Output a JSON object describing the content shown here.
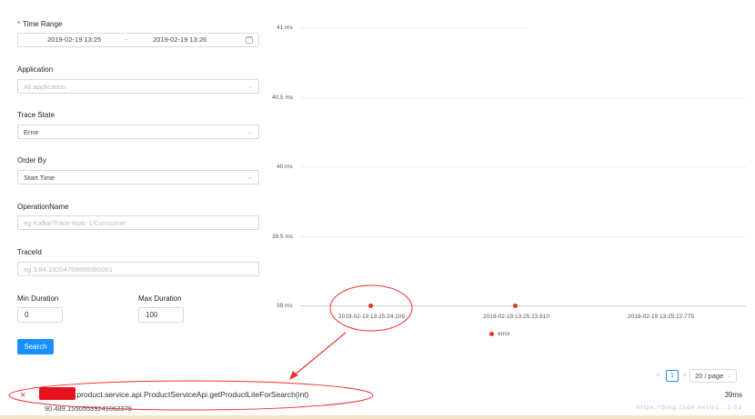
{
  "form": {
    "time_range": {
      "label": "Time Range",
      "start": "2019-02-19 13:25",
      "separator": "~",
      "end": "2019-02-19 13:26"
    },
    "application": {
      "label": "Application",
      "placeholder": "All application"
    },
    "trace_state": {
      "label": "Trace State",
      "value": "Error"
    },
    "order_by": {
      "label": "Order By",
      "value": "Start Time"
    },
    "operation_name": {
      "label": "OperationName",
      "placeholder": "eg Kafka/Trace-topic-1/Consumer"
    },
    "trace_id": {
      "label": "TraceId",
      "placeholder": "eg 3.84.15204769998380001"
    },
    "min_duration": {
      "label": "Min Duration",
      "value": "0"
    },
    "max_duration": {
      "label": "Max Duration",
      "value": "100"
    },
    "search_label": "Search"
  },
  "chart_data": {
    "type": "scatter",
    "y_ticks": [
      "41 ms",
      "40.5 ms",
      "40 ms",
      "39.5 ms",
      "39 ms"
    ],
    "ylim": [
      39,
      41
    ],
    "x_ticks": [
      "2019-02-19 13:25:24.106",
      "2019-02-19 13:25:23.810",
      "2019-02-19 13:25:22.775"
    ],
    "series": [
      {
        "name": "error",
        "color": "#e8322c",
        "points": [
          {
            "x": "2019-02-19 13:25:24.106",
            "y": 39
          },
          {
            "x": "2019-02-19 13:25:23.810",
            "y": 39
          }
        ]
      }
    ]
  },
  "pagination": {
    "prev": "<",
    "current_page": "1",
    "next": ">",
    "page_size": "20 / page"
  },
  "trace": {
    "operation_name": ".product.service.api.ProductServiceApi.getProductLiteForSearch(int)",
    "trace_id": "90.489.15505539241062379",
    "duration": "39ms",
    "watermark": "https://blog.csdn.net/s1...1.01"
  },
  "colors": {
    "primary": "#1890ff",
    "error": "#e8322c",
    "annotation": "#e8322c"
  }
}
